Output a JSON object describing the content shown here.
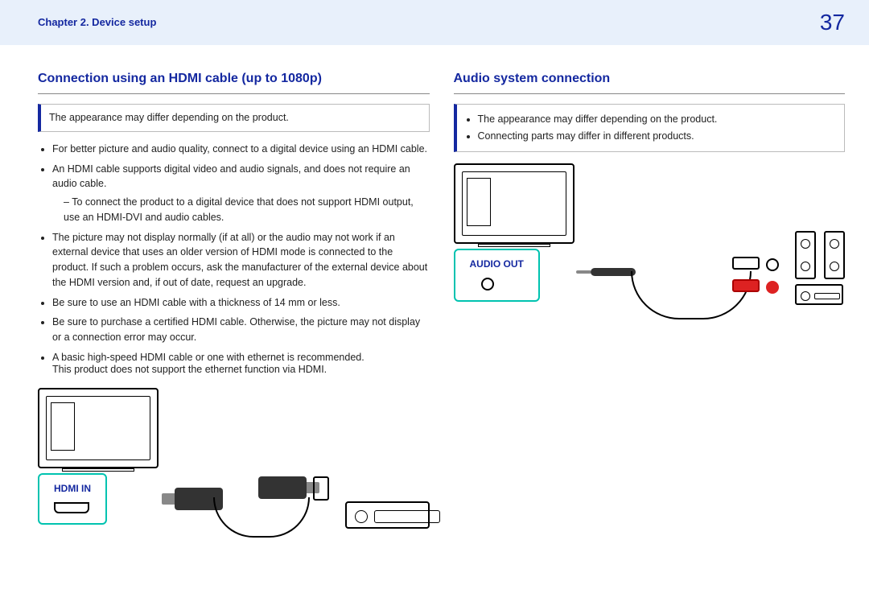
{
  "header": {
    "chapter": "Chapter 2. Device setup",
    "page": "37"
  },
  "left": {
    "heading": "Connection using an HDMI cable (up to 1080p)",
    "note": "The appearance may differ depending on the product.",
    "bullets": {
      "b1": "For better picture and audio quality, connect to a digital device using an HDMI cable.",
      "b2": "An HDMI cable supports digital video and audio signals, and does not require an audio cable.",
      "b2sub": "To connect the product to a digital device that does not support HDMI output, use an HDMI-DVI and audio cables.",
      "b3": "The picture may not display normally (if at all) or the audio may not work if an external device that uses an older version of HDMI mode is connected to the product. If such a problem occurs, ask the manufacturer of the external device about the HDMI version and, if out of date, request an upgrade.",
      "b4": "Be sure to use an HDMI cable with a thickness of 14 mm or less.",
      "b5": "Be sure to purchase a certified HDMI cable. Otherwise, the picture may not display or a connection error may occur.",
      "b6": "A basic high-speed HDMI cable or one with ethernet is recommended.",
      "b6cont": "This product does not support the ethernet function via HDMI."
    },
    "port_label": "HDMI IN"
  },
  "right": {
    "heading": "Audio system connection",
    "notes": {
      "n1": "The appearance may differ depending on the product.",
      "n2": "Connecting parts may differ in different products."
    },
    "port_label": "AUDIO OUT"
  }
}
